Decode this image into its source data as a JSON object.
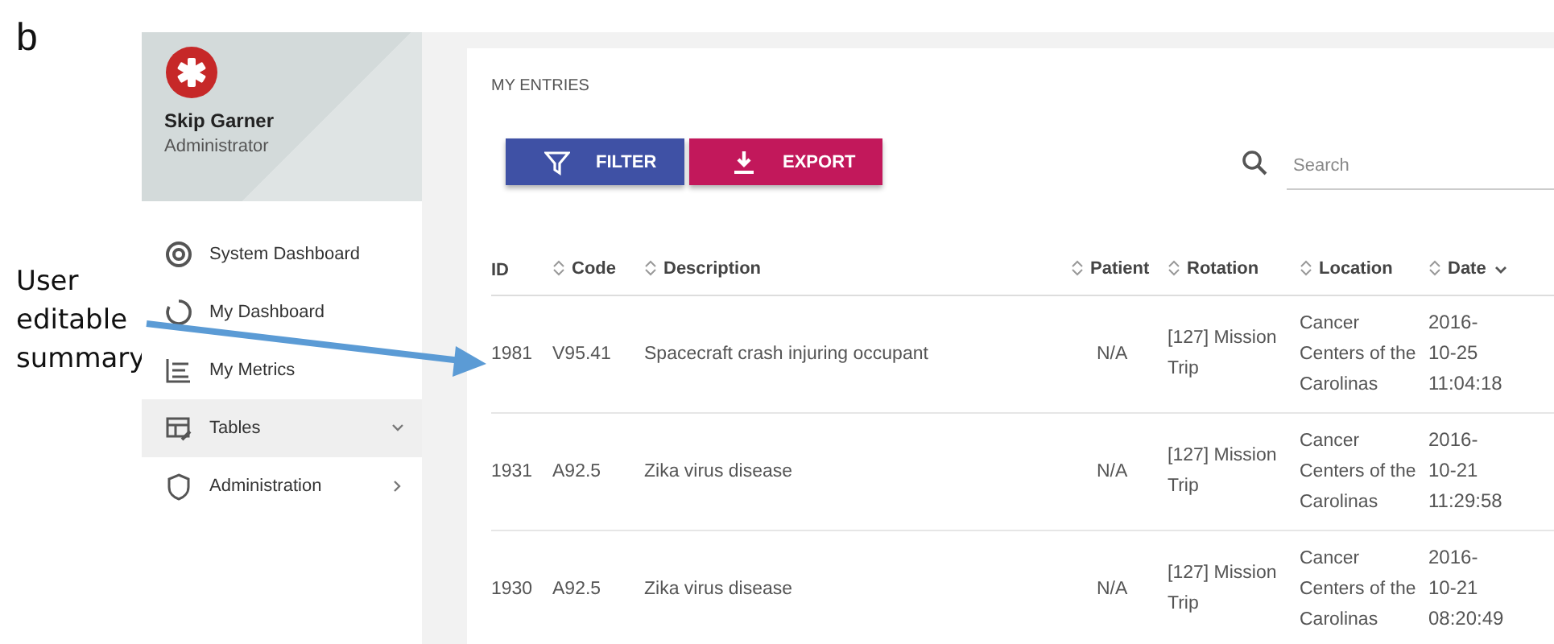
{
  "figure_label": "b",
  "annotation": {
    "text": "User editable summary"
  },
  "sidebar": {
    "user": {
      "name": "Skip Garner",
      "role": "Administrator"
    },
    "items": [
      {
        "label": "System Dashboard",
        "kind": "system",
        "selected": false
      },
      {
        "label": "My Dashboard",
        "kind": "ring",
        "selected": false
      },
      {
        "label": "My Metrics",
        "kind": "metrics",
        "selected": false
      },
      {
        "label": "Tables",
        "kind": "tables",
        "selected": true,
        "expanded": true
      },
      {
        "label": "Administration",
        "kind": "shield",
        "selected": false,
        "expanded": false
      }
    ]
  },
  "main": {
    "section_title": "MY ENTRIES",
    "buttons": [
      {
        "label": "FILTER",
        "kind": "filter"
      },
      {
        "label": "EXPORT",
        "kind": "export"
      }
    ],
    "search": {
      "placeholder": "Search"
    },
    "table": {
      "columns": [
        {
          "label": "ID",
          "sortable": false,
          "sorted": false
        },
        {
          "label": "Code",
          "sortable": true,
          "sorted": false
        },
        {
          "label": "Description",
          "sortable": true,
          "sorted": false
        },
        {
          "label": "Patient",
          "sortable": true,
          "sorted": false
        },
        {
          "label": "Rotation",
          "sortable": true,
          "sorted": false
        },
        {
          "label": "Location",
          "sortable": true,
          "sorted": false
        },
        {
          "label": "Date",
          "sortable": true,
          "sorted": true
        }
      ],
      "rows": [
        [
          "1981",
          "V95.41",
          "Spacecraft crash injuring occupant",
          "N/A",
          "[127] Mission Trip",
          "Cancer Centers of the Carolinas",
          "2016-10-25 11:04:18"
        ],
        [
          "1931",
          "A92.5",
          "Zika virus disease",
          "N/A",
          "[127] Mission Trip",
          "Cancer Centers of the Carolinas",
          "2016-10-21 11:29:58"
        ],
        [
          "1930",
          "A92.5",
          "Zika virus disease",
          "N/A",
          "[127] Mission Trip",
          "Cancer Centers of the Carolinas",
          "2016-10-21 08:20:49"
        ]
      ]
    }
  }
}
